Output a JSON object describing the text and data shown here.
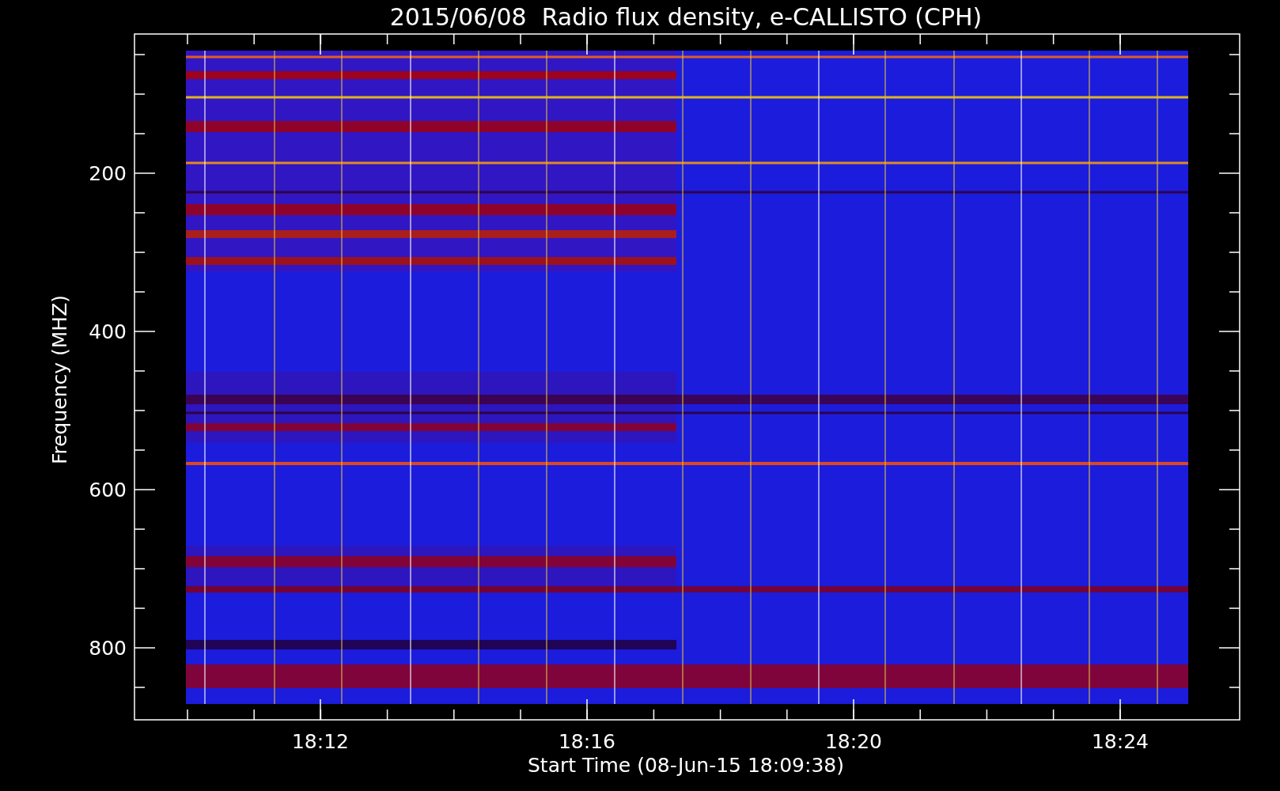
{
  "chart": {
    "title": "2015/06/08  Radio flux density, e-CALLISTO (CPH)",
    "ylabel": "Frequency (MHZ)",
    "xlabel": "Start Time (08-Jun-15 18:09:38)",
    "yticks": [
      "200",
      "400",
      "600",
      "800"
    ],
    "xticks": [
      "18:12",
      "18:16",
      "18:20",
      "18:24"
    ]
  }
}
